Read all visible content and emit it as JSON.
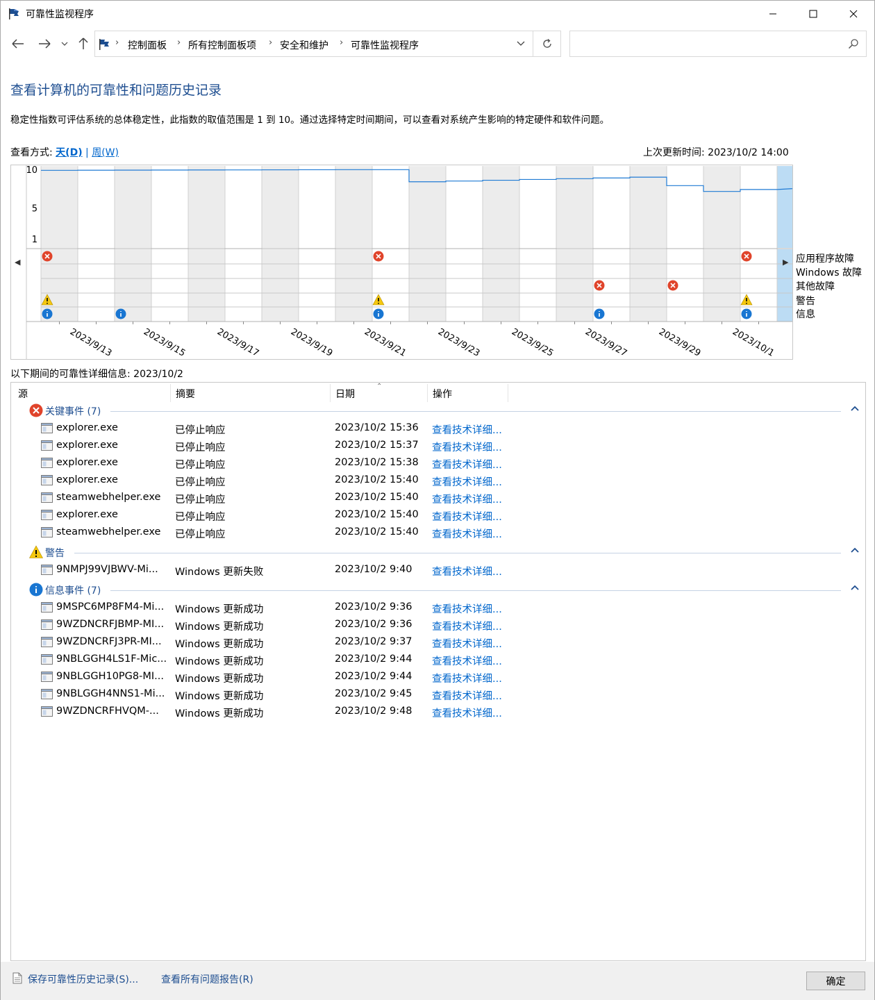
{
  "window": {
    "title": "可靠性监视程序"
  },
  "breadcrumbs": [
    "控制面板",
    "所有控制面板项",
    "安全和维护",
    "可靠性监视程序"
  ],
  "search": {
    "placeholder": ""
  },
  "heading": "查看计算机的可靠性和问题历史记录",
  "description": "稳定性指数可评估系统的总体稳定性，此指数的取值范围是 1 到 10。通过选择特定时间期间，可以查看对系统产生影响的特定硬件和软件问题。",
  "view_by": {
    "label": "查看方式:",
    "day": "天(D)",
    "sep": "|",
    "week": "周(W)"
  },
  "last_updated": "上次更新时间: 2023/10/2 14:00",
  "chart_data": {
    "type": "line",
    "y_ticks": [
      "10",
      "5",
      "1"
    ],
    "ylim": [
      1,
      10
    ],
    "x_labels": [
      "2023/9/13",
      "2023/9/15",
      "2023/9/17",
      "2023/9/19",
      "2023/9/21",
      "2023/9/23",
      "2023/9/25",
      "2023/9/27",
      "2023/9/29",
      "2023/10/1"
    ],
    "x": [
      "2023/9/12",
      "2023/9/13",
      "2023/9/14",
      "2023/9/15",
      "2023/9/16",
      "2023/9/17",
      "2023/9/18",
      "2023/9/19",
      "2023/9/20",
      "2023/9/21",
      "2023/9/22",
      "2023/9/23",
      "2023/9/24",
      "2023/9/25",
      "2023/9/26",
      "2023/9/27",
      "2023/9/28",
      "2023/9/29",
      "2023/9/30",
      "2023/10/1"
    ],
    "series": [
      {
        "values": [
          9.88,
          9.9,
          9.91,
          9.92,
          9.93,
          9.94,
          9.95,
          9.96,
          9.97,
          9.97,
          8.4,
          8.5,
          8.6,
          8.7,
          8.8,
          8.9,
          9.0,
          7.9,
          7.15,
          7.4
        ]
      }
    ],
    "selected_date": "2023/10/2",
    "row_labels": [
      "应用程序故障",
      "Windows 故障",
      "其他故障",
      "警告",
      "信息"
    ],
    "events": [
      {
        "date": "2023/9/12",
        "row": "应用程序故障",
        "type": "error"
      },
      {
        "date": "2023/9/21",
        "row": "应用程序故障",
        "type": "error"
      },
      {
        "date": "2023/10/1",
        "row": "应用程序故障",
        "type": "error"
      },
      {
        "date": "2023/9/27",
        "row": "其他故障",
        "type": "error"
      },
      {
        "date": "2023/9/29",
        "row": "其他故障",
        "type": "error"
      },
      {
        "date": "2023/9/12",
        "row": "警告",
        "type": "warning"
      },
      {
        "date": "2023/9/21",
        "row": "警告",
        "type": "warning"
      },
      {
        "date": "2023/10/1",
        "row": "警告",
        "type": "warning"
      },
      {
        "date": "2023/9/12",
        "row": "信息",
        "type": "info"
      },
      {
        "date": "2023/9/14",
        "row": "信息",
        "type": "info"
      },
      {
        "date": "2023/9/21",
        "row": "信息",
        "type": "info"
      },
      {
        "date": "2023/9/27",
        "row": "信息",
        "type": "info"
      },
      {
        "date": "2023/10/1",
        "row": "信息",
        "type": "info"
      }
    ],
    "colors": {
      "line": "#1f7ad4",
      "shade": "#ececec",
      "selected": "#bcdcf4",
      "error": "#e0442b",
      "warning": "#f5c80f",
      "info": "#1976d2"
    }
  },
  "details_title": "以下期间的可靠性详细信息: 2023/10/2",
  "columns": [
    "源",
    "摘要",
    "日期",
    "操作"
  ],
  "groups": [
    {
      "label": "关键事件 (7)",
      "icon": "error-icon",
      "rows": [
        {
          "source": "explorer.exe",
          "summary": "已停止响应",
          "date": "2023/10/2 15:36",
          "action": "查看技术详细..."
        },
        {
          "source": "explorer.exe",
          "summary": "已停止响应",
          "date": "2023/10/2 15:37",
          "action": "查看技术详细..."
        },
        {
          "source": "explorer.exe",
          "summary": "已停止响应",
          "date": "2023/10/2 15:38",
          "action": "查看技术详细..."
        },
        {
          "source": "explorer.exe",
          "summary": "已停止响应",
          "date": "2023/10/2 15:40",
          "action": "查看技术详细..."
        },
        {
          "source": "steamwebhelper.exe",
          "summary": "已停止响应",
          "date": "2023/10/2 15:40",
          "action": "查看技术详细..."
        },
        {
          "source": "explorer.exe",
          "summary": "已停止响应",
          "date": "2023/10/2 15:40",
          "action": "查看技术详细..."
        },
        {
          "source": "steamwebhelper.exe",
          "summary": "已停止响应",
          "date": "2023/10/2 15:40",
          "action": "查看技术详细..."
        }
      ]
    },
    {
      "label": "警告",
      "icon": "warning-icon",
      "rows": [
        {
          "source": "9NMPJ99VJBWV-Mi...",
          "summary": "Windows 更新失败",
          "date": "2023/10/2 9:40",
          "action": "查看技术详细..."
        }
      ]
    },
    {
      "label": "信息事件 (7)",
      "icon": "info-icon",
      "rows": [
        {
          "source": "9MSPC6MP8FM4-Mi...",
          "summary": "Windows 更新成功",
          "date": "2023/10/2 9:36",
          "action": "查看技术详细..."
        },
        {
          "source": "9WZDNCRFJBMP-MI...",
          "summary": "Windows 更新成功",
          "date": "2023/10/2 9:36",
          "action": "查看技术详细..."
        },
        {
          "source": "9WZDNCRFJ3PR-MI...",
          "summary": "Windows 更新成功",
          "date": "2023/10/2 9:37",
          "action": "查看技术详细..."
        },
        {
          "source": "9NBLGGH4LS1F-Mic...",
          "summary": "Windows 更新成功",
          "date": "2023/10/2 9:44",
          "action": "查看技术详细..."
        },
        {
          "source": "9NBLGGH10PG8-MI...",
          "summary": "Windows 更新成功",
          "date": "2023/10/2 9:44",
          "action": "查看技术详细..."
        },
        {
          "source": "9NBLGGH4NNS1-Mi...",
          "summary": "Windows 更新成功",
          "date": "2023/10/2 9:45",
          "action": "查看技术详细..."
        },
        {
          "source": "9WZDNCRFHVQM-...",
          "summary": "Windows 更新成功",
          "date": "2023/10/2 9:48",
          "action": "查看技术详细..."
        }
      ]
    }
  ],
  "footer": {
    "save_link": "保存可靠性历史记录(S)...",
    "reports_link": "查看所有问题报告(R)",
    "ok_button": "确定"
  }
}
